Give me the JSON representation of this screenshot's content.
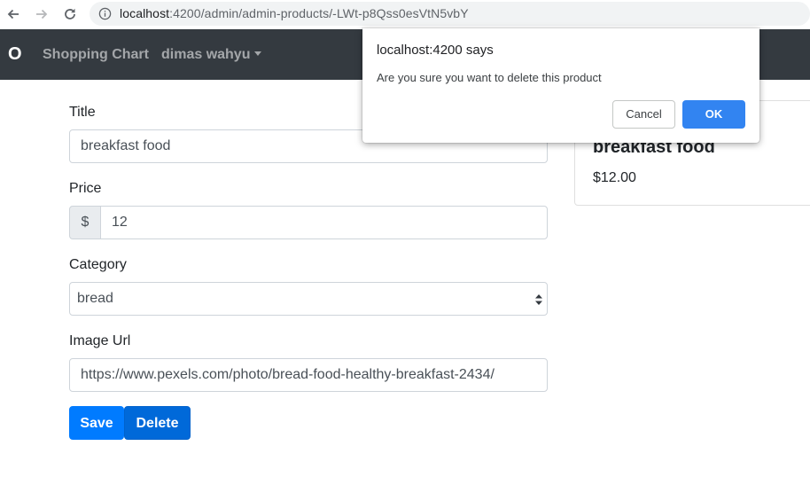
{
  "browser": {
    "url_host": "localhost",
    "url_path": ":4200/admin/admin-products/-LWt-p8Qss0esVtN5vbY",
    "icons": [
      "back-icon",
      "forward-icon",
      "reload-icon",
      "info-icon"
    ]
  },
  "navbar": {
    "brand": "O",
    "links": [
      "Shopping Chart"
    ],
    "user_menu": "dimas wahyu",
    "background": "#343a40"
  },
  "form": {
    "title_label": "Title",
    "title_value": "breakfast food",
    "price_label": "Price",
    "price_prefix": "$",
    "price_value": "12",
    "category_label": "Category",
    "category_selected": "bread",
    "image_label": "Image Url",
    "image_value": "https://www.pexels.com/photo/bread-food-healthy-breakfast-2434/",
    "save_label": "Save",
    "delete_label": "Delete",
    "accent_color": "#007bff"
  },
  "preview": {
    "title": "breakfast food",
    "price": "$12.00"
  },
  "dialog": {
    "title": "localhost:4200 says",
    "message": "Are you sure you want to delete this product",
    "cancel_label": "Cancel",
    "ok_label": "OK"
  }
}
